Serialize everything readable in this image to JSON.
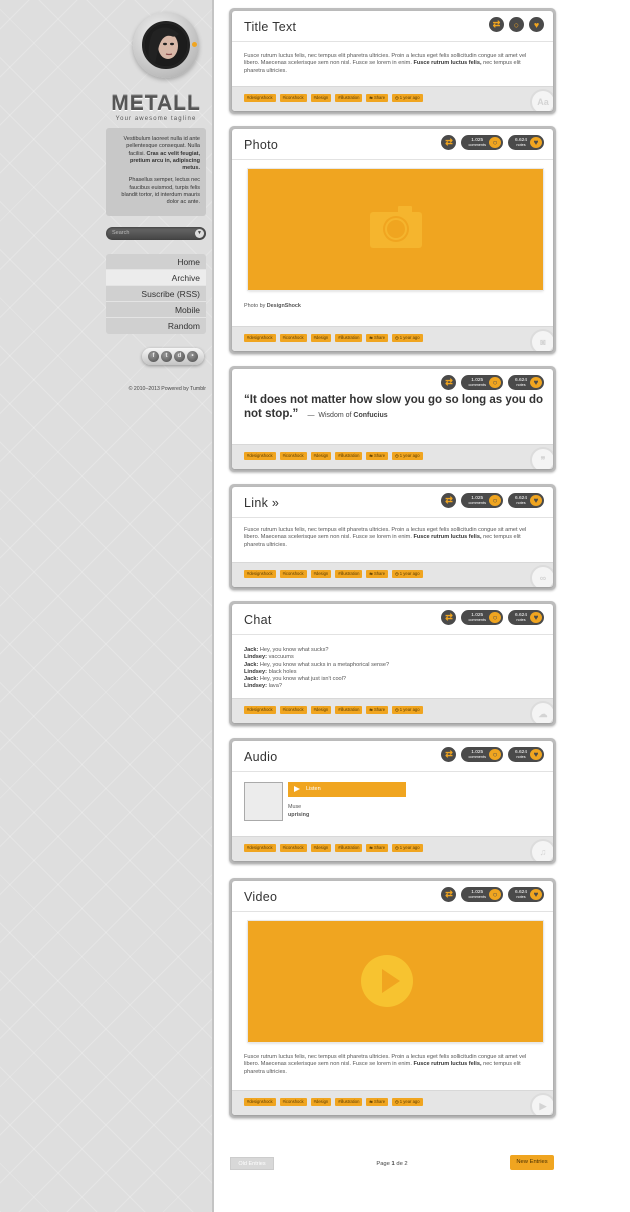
{
  "sidebar": {
    "logo": "METALL",
    "tagline": "Your awesome tagline",
    "desc1": "Vestibulum laoreet nulla id ante pellentesque consequat. Nulla facilisi.",
    "desc_bold": "Cras ac velit feugiat, pretium arcu in, adipiscing metus.",
    "desc2": "Phasellus semper, lectus nec faucibus euismod, turpis felis blandit tortor, id interdum mauris dolor ac ante.",
    "search_placeholder": "Search",
    "nav": [
      "Home",
      "Archive",
      "Suscribe (RSS)",
      "Mobile",
      "Random"
    ],
    "copyright": "© 2010–2013 Powered by Tumblr"
  },
  "common": {
    "tags": [
      "#designshock",
      "#iconshock",
      "#design",
      "#illustration"
    ],
    "share": "Share",
    "time": "1 year ago",
    "comments_num": "1.025",
    "comments_lbl": "comments",
    "notes_num": "6.624",
    "notes_lbl": "notes",
    "lorem_a": "Fusce rutrum luctus felis, nec tempus elit pharetra ultricies. Proin a lectus eget felis sollicitudin congue sit amet vel libero. Maecenas scelerisque sem non nisl.  Fusce se lorem in enim. ",
    "lorem_bold": "Fusce rutrum luctus felis,",
    "lorem_b": " nec tempus elit pharetra ultricies."
  },
  "posts": {
    "text": {
      "title": "Title Text"
    },
    "photo": {
      "title": "Photo",
      "credit_prefix": "Photo by ",
      "credit_name": "DesignShock"
    },
    "quote": {
      "text": "“It does not matter how slow you go so long as you do not stop.”",
      "dash": "—",
      "src_prefix": "Wisdom of ",
      "src_name": "Confucius"
    },
    "link": {
      "title": "Link »"
    },
    "chat": {
      "title": "Chat",
      "lines": [
        {
          "who": "Jack:",
          "say": " Hey, you know what sucks?"
        },
        {
          "who": "Lindsey:",
          "say": " vaccuums"
        },
        {
          "who": "Jack:",
          "say": " Hey, you know what sucks in a metaphorical sense?"
        },
        {
          "who": "Lindsey:",
          "say": " black holes"
        },
        {
          "who": "Jack:",
          "say": " Hey, you know what just isn't cool?"
        },
        {
          "who": "Lindsey:",
          "say": " lava?"
        }
      ]
    },
    "audio": {
      "title": "Audio",
      "listen": "Listen",
      "artist": "Muse",
      "track": "uprising"
    },
    "video": {
      "title": "Video"
    }
  },
  "pagination": {
    "old": "Old Entries",
    "page_prefix": "Page ",
    "page_num": "1",
    "page_suffix": " de 2",
    "new": "New Entries"
  },
  "colors": {
    "accent": "#f0a520",
    "dark": "#4a4a4a",
    "sidebar_bg": "#dedede"
  }
}
